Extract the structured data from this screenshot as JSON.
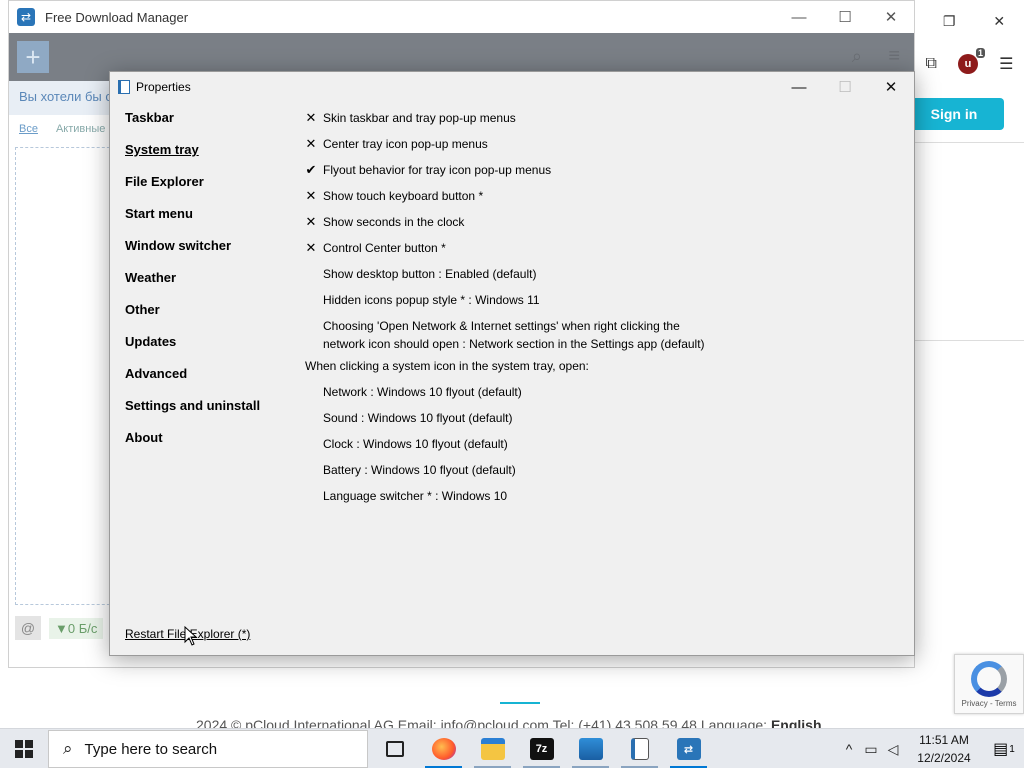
{
  "background": {
    "signin_label": "Sign in",
    "footer_text": "2024 © pCloud International AG  Email: info@pcloud.com  Tel: (+41) 43 508 59 48  Language:",
    "footer_language": "English",
    "recaptcha_text": "Privacy - Terms",
    "extension_badge": "1"
  },
  "fdm": {
    "title": "Free Download Manager",
    "hint": "Вы хотели бы с",
    "tabs": [
      "Все",
      "Активные"
    ],
    "speed": "▼0 Б/с"
  },
  "properties": {
    "title": "Properties",
    "nav": [
      {
        "label": "Taskbar",
        "active": false
      },
      {
        "label": "System tray",
        "active": true
      },
      {
        "label": "File Explorer",
        "active": false
      },
      {
        "label": "Start menu",
        "active": false
      },
      {
        "label": "Window switcher",
        "active": false
      },
      {
        "label": "Weather",
        "active": false
      },
      {
        "label": "Other",
        "active": false
      },
      {
        "label": "Updates",
        "active": false
      },
      {
        "label": "Advanced",
        "active": false
      },
      {
        "label": "Settings and uninstall",
        "active": false
      },
      {
        "label": "About",
        "active": false
      }
    ],
    "options": [
      {
        "mark": "✕",
        "label": "Skin taskbar and tray pop-up menus"
      },
      {
        "mark": "✕",
        "label": "Center tray icon pop-up menus"
      },
      {
        "mark": "✔",
        "label": "Flyout behavior for tray icon pop-up menus"
      },
      {
        "mark": "✕",
        "label": "Show touch keyboard button *"
      },
      {
        "mark": "✕",
        "label": "Show seconds in the clock"
      },
      {
        "mark": "✕",
        "label": "Control Center button *"
      },
      {
        "mark": "",
        "label": "Show desktop button : Enabled (default)"
      },
      {
        "mark": "",
        "label": "Hidden icons popup style * : Windows 11"
      },
      {
        "mark": "",
        "label": "Choosing 'Open Network & Internet settings' when right clicking the network icon should open : Network section in the Settings app (default)"
      }
    ],
    "section_heading": "When clicking a system icon in the system tray, open:",
    "tray_open_options": [
      "Network : Windows 10 flyout (default)",
      "Sound : Windows 10 flyout (default)",
      "Clock : Windows 10 flyout (default)",
      "Battery : Windows 10 flyout (default)",
      "Language switcher * : Windows 10"
    ],
    "restart_link": "Restart File Explorer (*)"
  },
  "taskbar": {
    "search_placeholder": "Type here to search",
    "apps": [
      "Task View",
      "Firefox",
      "File Explorer",
      "7-Zip",
      "Photos",
      "Properties",
      "Free Download Manager"
    ],
    "sevenzip_label": "7z",
    "clock_time": "11:51 AM",
    "clock_date": "12/2/2024",
    "notification_count": "1"
  }
}
